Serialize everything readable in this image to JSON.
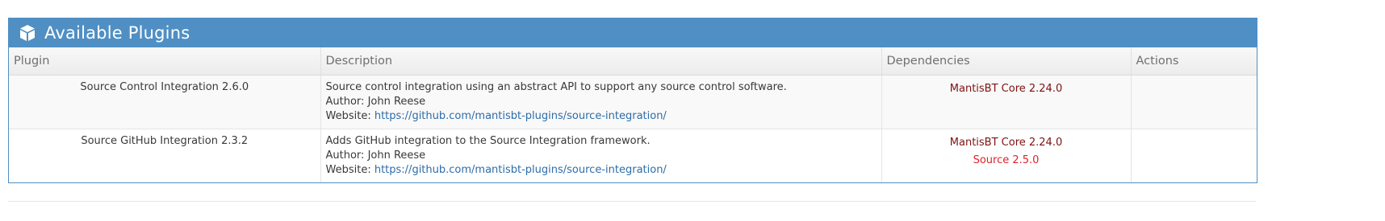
{
  "widget": {
    "title": "Available Plugins",
    "icon": "cube-icon",
    "header_color": "#4f8fc4"
  },
  "table": {
    "headers": {
      "plugin": "Plugin",
      "description": "Description",
      "dependencies": "Dependencies",
      "actions": "Actions"
    },
    "rows": [
      {
        "plugin": "Source Control Integration 2.6.0",
        "description": "Source control integration using an abstract API to support any source control software.",
        "author_prefix": "Author:",
        "author": "John Reese",
        "website_prefix": "Website:",
        "website": "https://github.com/mantisbt-plugins/source-integration/",
        "dependencies": [
          "MantisBT Core 2.24.0"
        ],
        "actions": ""
      },
      {
        "plugin": "Source GitHub Integration 2.3.2",
        "description": "Adds GitHub integration to the Source Integration framework.",
        "author_prefix": "Author:",
        "author": "John Reese",
        "website_prefix": "Website:",
        "website": "https://github.com/mantisbt-plugins/source-integration/",
        "dependencies": [
          "MantisBT Core 2.24.0",
          "Source 2.5.0"
        ],
        "actions": ""
      }
    ]
  },
  "colors": {
    "dependency_met": "#7e1111",
    "dependency_warning": "#e0212a",
    "link": "#2e6ca8"
  }
}
